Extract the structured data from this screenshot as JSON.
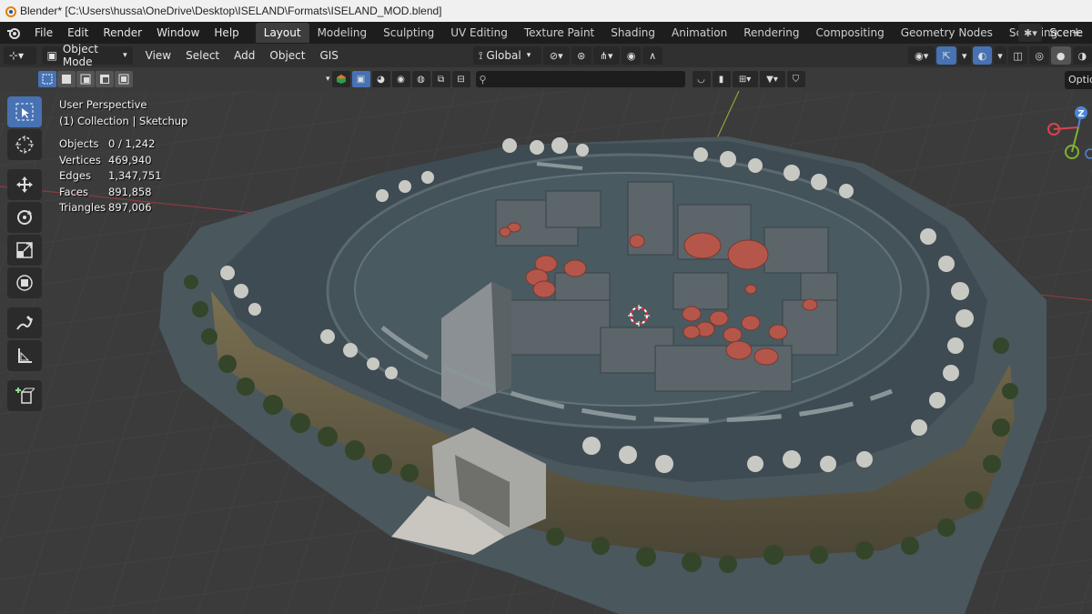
{
  "window": {
    "title": "Blender* [C:\\Users\\hussa\\OneDrive\\Desktop\\ISELAND\\Formats\\ISELAND_MOD.blend]"
  },
  "topbar": {
    "menus": [
      "File",
      "Edit",
      "Render",
      "Window",
      "Help"
    ],
    "workspaces": [
      "Layout",
      "Modeling",
      "Sculpting",
      "UV Editing",
      "Texture Paint",
      "Shading",
      "Animation",
      "Rendering",
      "Compositing",
      "Geometry Nodes",
      "Scripting"
    ],
    "active_workspace": "Layout",
    "add_tab": "+",
    "scene_label": "Scene"
  },
  "viewport_header": {
    "mode": "Object Mode",
    "menus": [
      "View",
      "Select",
      "Add",
      "Object",
      "GIS"
    ],
    "transform_orientation": "Global"
  },
  "options_label": "Optio",
  "search": {
    "value": "",
    "placeholder": ""
  },
  "overlay": {
    "view_name": "User Perspective",
    "collection": "(1) Collection | Sketchup",
    "stats": [
      {
        "label": "Objects",
        "value": "0 / 1,242"
      },
      {
        "label": "Vertices",
        "value": "469,940"
      },
      {
        "label": "Edges",
        "value": "1,347,751"
      },
      {
        "label": "Faces",
        "value": "891,858"
      },
      {
        "label": "Triangles",
        "value": "897,006"
      }
    ]
  },
  "gizmo": {
    "axis_z": "Z"
  },
  "colors": {
    "accent": "#4772b3",
    "tank": "#b4574a",
    "grid_line_x": "#a23a44",
    "grid_line_y": "#8ea33a",
    "platform": "#3f4d54",
    "cliff": "#6b6248"
  },
  "toolbar_icons": [
    "select-box-icon",
    "cursor-icon",
    "move-icon",
    "rotate-icon",
    "scale-icon",
    "transform-icon",
    "annotate-icon",
    "measure-icon",
    "add-cube-icon"
  ]
}
